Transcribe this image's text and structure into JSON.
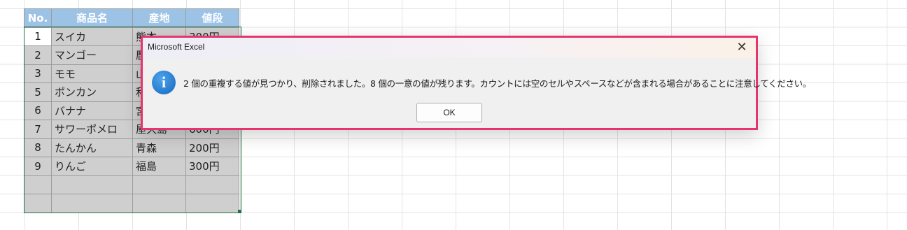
{
  "sheet": {
    "headers": [
      "No.",
      "商品名",
      "産地",
      "値段"
    ],
    "rows": [
      {
        "no": "1",
        "name": "スイカ",
        "origin": "熊本",
        "price": "300円"
      },
      {
        "no": "2",
        "name": "マンゴー",
        "origin": "鹿",
        "price": ""
      },
      {
        "no": "3",
        "name": "モモ",
        "origin": "山",
        "price": ""
      },
      {
        "no": "5",
        "name": "ポンカン",
        "origin": "和",
        "price": ""
      },
      {
        "no": "6",
        "name": "バナナ",
        "origin": "宮",
        "price": ""
      },
      {
        "no": "7",
        "name": "サワーポメロ",
        "origin": "屋久島",
        "price": "600円"
      },
      {
        "no": "8",
        "name": "たんかん",
        "origin": "青森",
        "price": "200円"
      },
      {
        "no": "9",
        "name": "りんご",
        "origin": "福島",
        "price": "300円"
      }
    ]
  },
  "dialog": {
    "title": "Microsoft Excel",
    "close_glyph": "✕",
    "icon": "info-icon",
    "icon_glyph": "i",
    "message": "2 個の重複する値が見つかり、削除されました。8 個の一意の値が残ります。カウントには空のセルやスペースなどが含まれる場合があることに注意してください。",
    "ok_label": "OK"
  },
  "colors": {
    "header_bg": "#9cc2e5",
    "selected_bg": "#cfcfcf",
    "dialog_border": "#e5356d",
    "info_blue": "#1976d2"
  }
}
